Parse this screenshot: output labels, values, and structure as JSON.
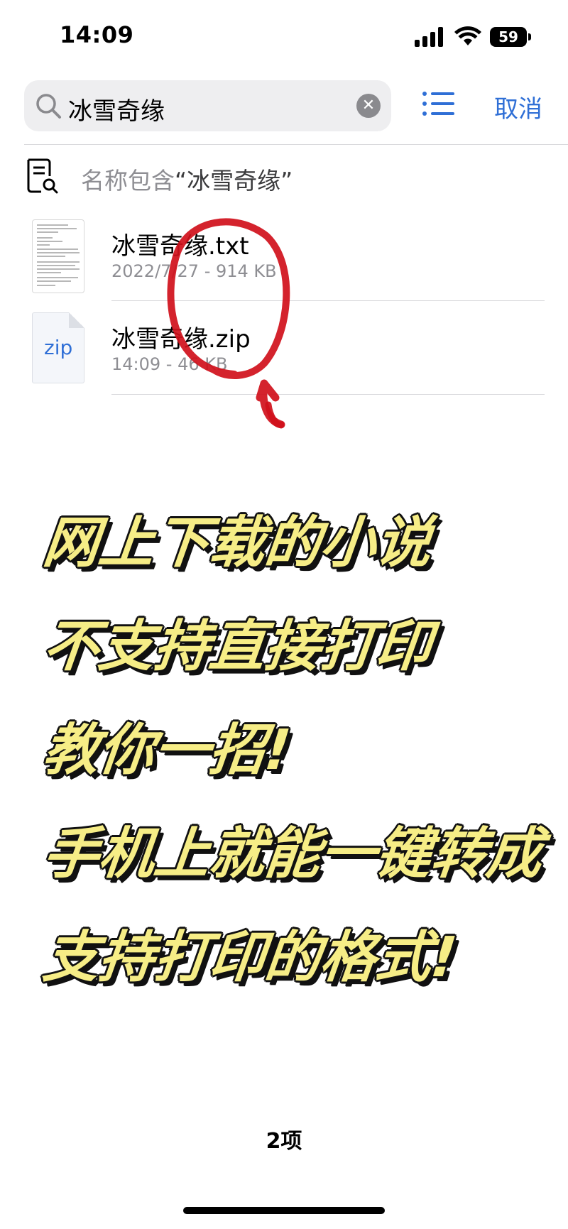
{
  "status_bar": {
    "time": "14:09",
    "battery_level": "59",
    "signal_bars": 4,
    "wifi_icon": "wifi-icon"
  },
  "search": {
    "query": "冰雪奇缘",
    "cancel_label": "取消"
  },
  "filter": {
    "prefix": "名称包含",
    "term": "“冰雪奇缘”"
  },
  "files": [
    {
      "name": "冰雪奇缘.txt",
      "meta": "2022/7/27 - 914 KB",
      "type": "txt"
    },
    {
      "name": "冰雪奇缘.zip",
      "meta": "14:09 - 46 KB",
      "type": "zip",
      "thumb_label": "zip"
    }
  ],
  "captions": [
    "网上下载的小说",
    "不支持直接打印",
    "教你一招!",
    "手机上就能一键转成",
    "支持打印的格式!"
  ],
  "footer": {
    "item_count": "2项"
  },
  "colors": {
    "accent": "#2f6fd6",
    "annotation": "#d0101b",
    "caption_fill": "#f6ed86",
    "caption_outline": "#111111",
    "secondary_text": "#8e8e93"
  }
}
